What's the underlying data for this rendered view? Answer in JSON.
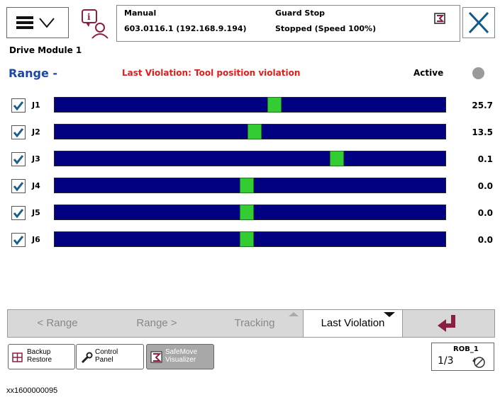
{
  "header": {
    "mode": "Manual",
    "controller": "603.0116.1 (192.168.9.194)",
    "guard_state": "Guard Stop",
    "speed_state": "Stopped (Speed 100%)"
  },
  "drive_module": "Drive Module 1",
  "range_title": "Range -",
  "violation_text": "Last Violation: Tool position violation",
  "active_label": "Active",
  "joints": [
    {
      "label": "J1",
      "value": "25.7",
      "checked": true,
      "position": 0.56
    },
    {
      "label": "J2",
      "value": "13.5",
      "checked": true,
      "position": 0.51
    },
    {
      "label": "J3",
      "value": "0.1",
      "checked": true,
      "position": 0.72
    },
    {
      "label": "J4",
      "value": "0.0",
      "checked": true,
      "position": 0.49
    },
    {
      "label": "J5",
      "value": "0.0",
      "checked": true,
      "position": 0.49
    },
    {
      "label": "J6",
      "value": "0.0",
      "checked": true,
      "position": 0.49
    }
  ],
  "tabs": {
    "prev": "< Range",
    "next": "Range >",
    "tracking": "Tracking",
    "last_violation": "Last Violation"
  },
  "taskbar": {
    "backup_line1": "Backup",
    "backup_line2": "Restore",
    "control_line1": "Control",
    "control_line2": "Panel",
    "safemove_line1": "SafeMove",
    "safemove_line2": "Visualizer",
    "rob_label": "ROB_1",
    "fraction": "1/3"
  },
  "caption": "xx1600000095",
  "colors": {
    "bar": "#000080",
    "thumb": "#33cc33",
    "violation": "#e21b1b",
    "title": "#1b48a8"
  }
}
